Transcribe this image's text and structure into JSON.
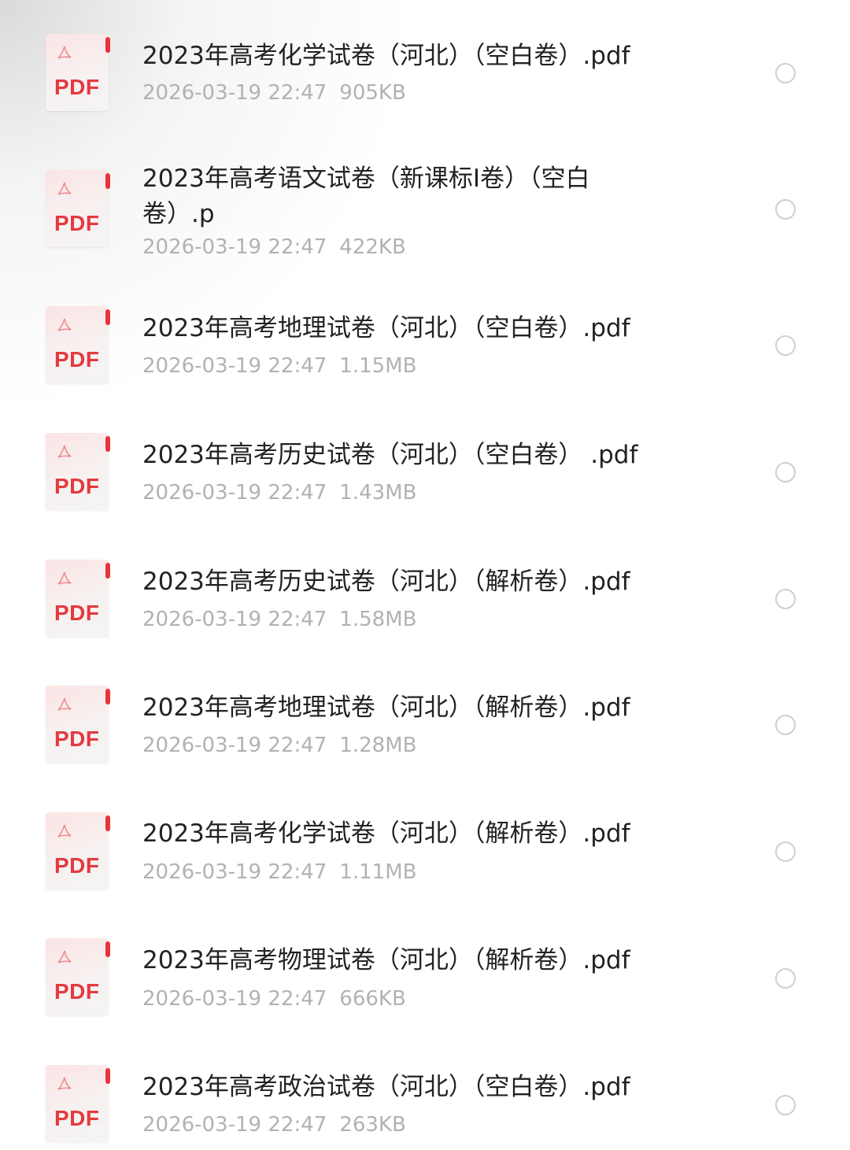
{
  "files": [
    {
      "name": "2023年高考化学试卷（河北）（空白卷）.pdf",
      "date": "2026-03-19 22:47",
      "size": "905KB",
      "icon_label": "PDF",
      "icon": "pdf-file-icon"
    },
    {
      "name": "2023年高考语文试卷（新课标Ⅰ卷）（空白卷）.p",
      "date": "2026-03-19 22:47",
      "size": "422KB",
      "icon_label": "PDF",
      "icon": "pdf-file-icon"
    },
    {
      "name": "2023年高考地理试卷（河北）（空白卷）.pdf",
      "date": "2026-03-19 22:47",
      "size": "1.15MB",
      "icon_label": "PDF",
      "icon": "pdf-file-icon"
    },
    {
      "name": "2023年高考历史试卷（河北）（空白卷） .pdf",
      "date": "2026-03-19 22:47",
      "size": "1.43MB",
      "icon_label": "PDF",
      "icon": "pdf-file-icon"
    },
    {
      "name": "2023年高考历史试卷（河北）（解析卷）.pdf",
      "date": "2026-03-19 22:47",
      "size": "1.58MB",
      "icon_label": "PDF",
      "icon": "pdf-file-icon"
    },
    {
      "name": "2023年高考地理试卷（河北）（解析卷）.pdf",
      "date": "2026-03-19 22:47",
      "size": "1.28MB",
      "icon_label": "PDF",
      "icon": "pdf-file-icon"
    },
    {
      "name": "2023年高考化学试卷（河北）（解析卷）.pdf",
      "date": "2026-03-19 22:47",
      "size": "1.11MB",
      "icon_label": "PDF",
      "icon": "pdf-file-icon"
    },
    {
      "name": "2023年高考物理试卷（河北）（解析卷）.pdf",
      "date": "2026-03-19 22:47",
      "size": "666KB",
      "icon_label": "PDF",
      "icon": "pdf-file-icon"
    },
    {
      "name": "2023年高考政治试卷（河北）（空白卷）.pdf",
      "date": "2026-03-19 22:47",
      "size": "263KB",
      "icon_label": "PDF",
      "icon": "pdf-file-icon"
    }
  ],
  "colors": {
    "pdf_red": "#e43a3f",
    "title_text": "#222222",
    "meta_text": "#b2b2b2",
    "radio_border": "#cfcfcf"
  }
}
